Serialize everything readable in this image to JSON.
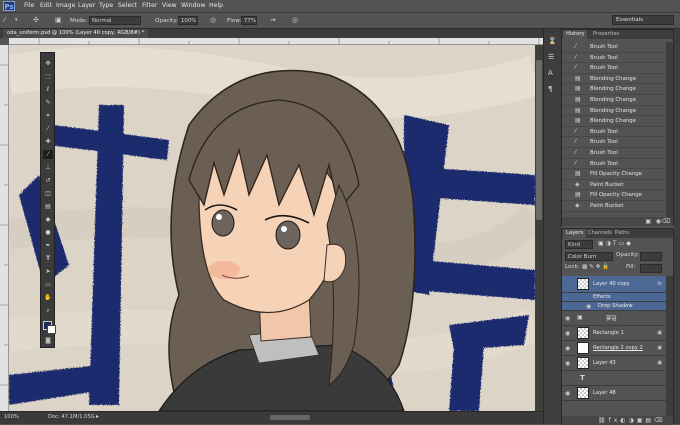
{
  "app": {
    "logo": "Ps"
  },
  "menu": [
    "File",
    "Edit",
    "Image",
    "Layer",
    "Type",
    "Select",
    "Filter",
    "View",
    "Window",
    "Help"
  ],
  "options": {
    "mode_label": "Mode:",
    "mode_value": "Normal",
    "opacity_label": "Opacity:",
    "opacity_value": "100%",
    "flow_label": "Flow:",
    "flow_value": "77%",
    "workspace": "Essentials"
  },
  "document": {
    "tab_title": "oda_uniform.psd @ 100% (Layer 40 copy, RGB/8#) *",
    "zoom": "100%",
    "doc_info": "Doc: 47.1M/1.05G"
  },
  "history": {
    "tabs": [
      "History",
      "Properties"
    ],
    "items": [
      "Brush Tool",
      "Brush Tool",
      "Brush Tool",
      "Blending Change",
      "Blending Change",
      "Blending Change",
      "Blending Change",
      "Blending Change",
      "Brush Tool",
      "Brush Tool",
      "Brush Tool",
      "Brush Tool",
      "Fill Opacity Change",
      "Paint Bucket",
      "Fill Opacity Change",
      "Paint Bucket"
    ]
  },
  "layers": {
    "tabs": [
      "Layers",
      "Channels",
      "Paths"
    ],
    "filter_kind": "Kind",
    "blend_mode": "Color Burn",
    "opacity_label": "Opacity:",
    "lock_label": "Lock:",
    "fill_label": "Fill:",
    "rows": [
      {
        "name": "Layer 40 copy",
        "fx": "fx"
      },
      {
        "name": "Effects"
      },
      {
        "name": "Drop Shadow"
      },
      {
        "name": "夢冠"
      },
      {
        "name": "Rectangle 1"
      },
      {
        "name": "Rectangle 2 copy 2"
      },
      {
        "name": "Layer 43"
      },
      {
        "name": "T"
      },
      {
        "name": "Layer 48"
      }
    ]
  }
}
